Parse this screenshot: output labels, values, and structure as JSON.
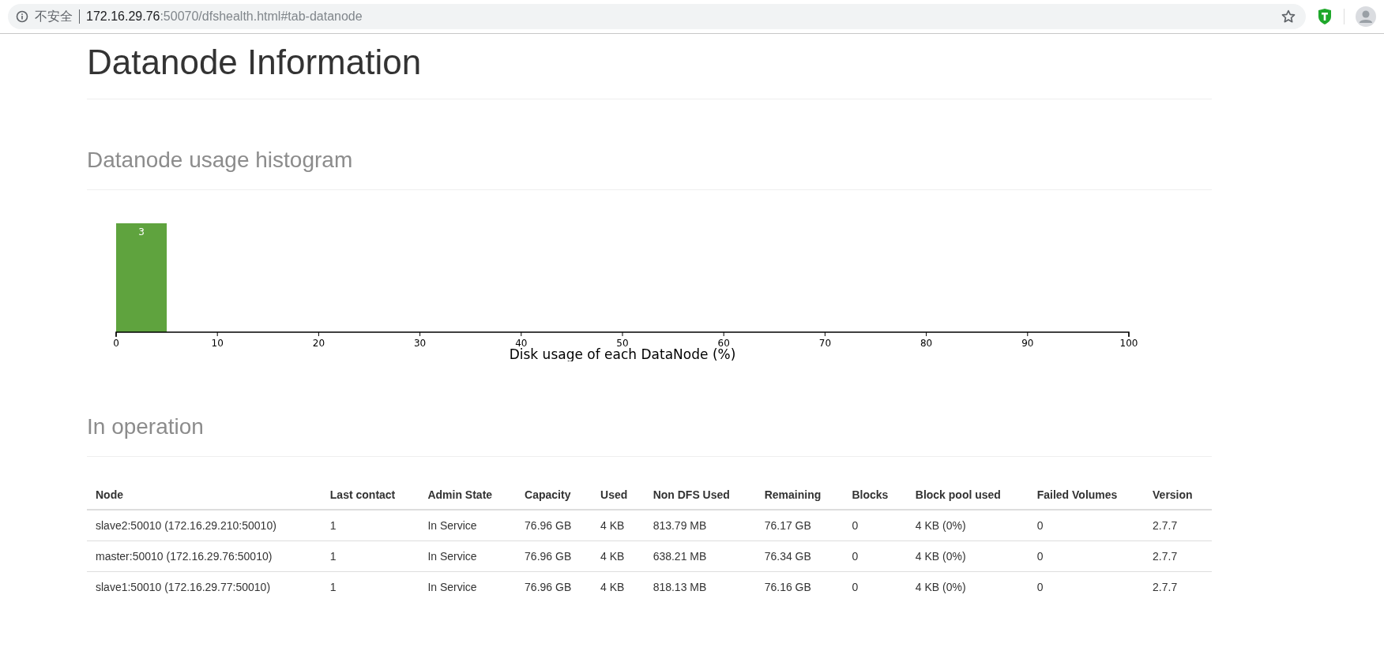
{
  "browser": {
    "security": "不安全",
    "url_host": "172.16.29.76",
    "url_path": ":50070/dfshealth.html#tab-datanode"
  },
  "title": "Datanode Information",
  "histogram": {
    "heading": "Datanode usage histogram",
    "chart_data": {
      "type": "bar",
      "xlabel": "Disk usage of each DataNode (%)",
      "x": [
        2.5
      ],
      "values": [
        3
      ],
      "color": "#5fa33e",
      "xlim": [
        0,
        100
      ],
      "xticks": [
        0,
        10,
        20,
        30,
        40,
        50,
        60,
        70,
        80,
        90,
        100
      ],
      "data_labels": true
    }
  },
  "operation": {
    "heading": "In operation",
    "columns": [
      "Node",
      "Last contact",
      "Admin State",
      "Capacity",
      "Used",
      "Non DFS Used",
      "Remaining",
      "Blocks",
      "Block pool used",
      "Failed Volumes",
      "Version"
    ],
    "rows": [
      [
        "slave2:50010 (172.16.29.210:50010)",
        "1",
        "In Service",
        "76.96 GB",
        "4 KB",
        "813.79 MB",
        "76.17 GB",
        "0",
        "4 KB (0%)",
        "0",
        "2.7.7"
      ],
      [
        "master:50010 (172.16.29.76:50010)",
        "1",
        "In Service",
        "76.96 GB",
        "4 KB",
        "638.21 MB",
        "76.34 GB",
        "0",
        "4 KB (0%)",
        "0",
        "2.7.7"
      ],
      [
        "slave1:50010 (172.16.29.77:50010)",
        "1",
        "In Service",
        "76.96 GB",
        "4 KB",
        "818.13 MB",
        "76.16 GB",
        "0",
        "4 KB (0%)",
        "0",
        "2.7.7"
      ]
    ]
  }
}
